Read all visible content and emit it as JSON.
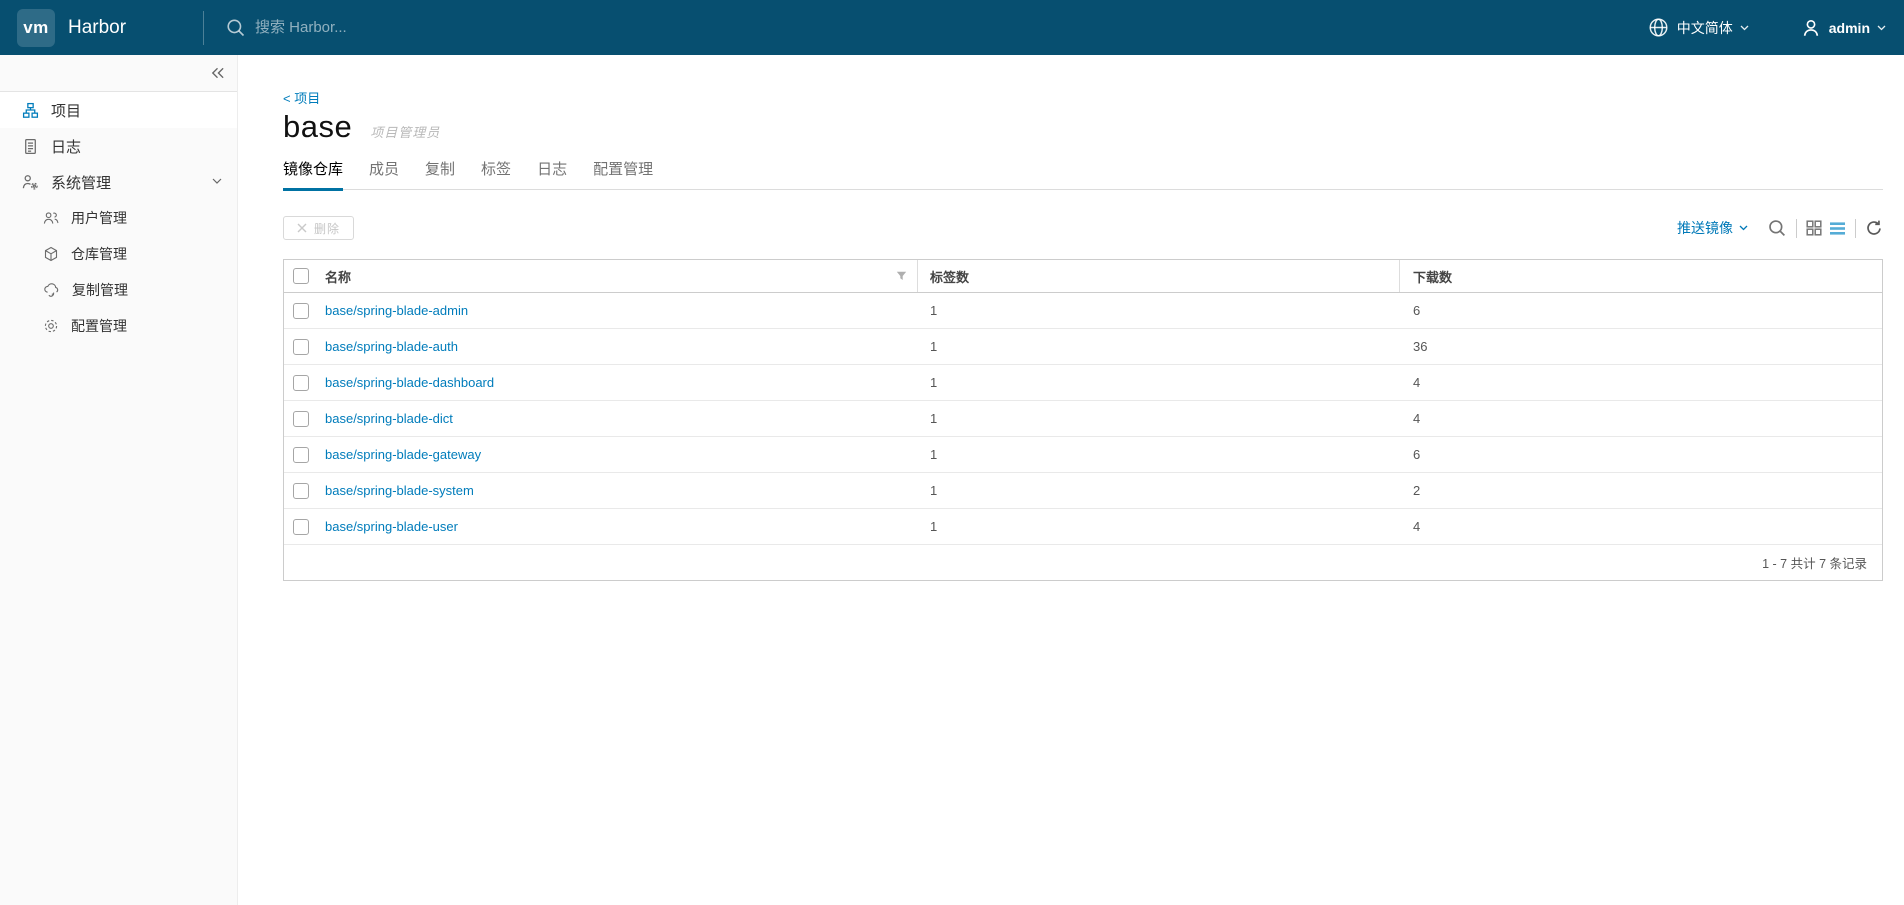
{
  "colors": {
    "header_bg": "#074F70",
    "link_blue": "#007CBB",
    "tab_active_underline": "#0072A3",
    "push_button_blue": "#0079B8",
    "sidebar_bg": "#FAFAFA"
  },
  "header": {
    "logo_text": "vm",
    "product_name": "Harbor",
    "search_placeholder": "搜索 Harbor...",
    "language_label": "中文简体",
    "user_name": "admin"
  },
  "sidebar": {
    "items": [
      {
        "label": "项目",
        "icon": "projects-icon",
        "active": true
      },
      {
        "label": "日志",
        "icon": "logs-icon",
        "active": false
      },
      {
        "label": "系统管理",
        "icon": "administration-icon",
        "active": false,
        "expanded": true
      }
    ],
    "subitems": [
      {
        "label": "用户管理",
        "icon": "users-icon"
      },
      {
        "label": "仓库管理",
        "icon": "registry-icon"
      },
      {
        "label": "复制管理",
        "icon": "replication-icon"
      },
      {
        "label": "配置管理",
        "icon": "config-icon"
      }
    ]
  },
  "main": {
    "breadcrumb": "< 项目",
    "title": "base",
    "role_label": "项目管理员",
    "tabs": [
      {
        "label": "镜像仓库",
        "active": true
      },
      {
        "label": "成员",
        "active": false
      },
      {
        "label": "复制",
        "active": false
      },
      {
        "label": "标签",
        "active": false
      },
      {
        "label": "日志",
        "active": false
      },
      {
        "label": "配置管理",
        "active": false
      }
    ],
    "toolbar": {
      "delete_label": "删除",
      "push_image_label": "推送镜像"
    },
    "table": {
      "columns": [
        {
          "label": "名称"
        },
        {
          "label": "标签数"
        },
        {
          "label": "下载数"
        }
      ],
      "rows": [
        {
          "name": "base/spring-blade-admin",
          "tags": "1",
          "pulls": "6"
        },
        {
          "name": "base/spring-blade-auth",
          "tags": "1",
          "pulls": "36"
        },
        {
          "name": "base/spring-blade-dashboard",
          "tags": "1",
          "pulls": "4"
        },
        {
          "name": "base/spring-blade-dict",
          "tags": "1",
          "pulls": "4"
        },
        {
          "name": "base/spring-blade-gateway",
          "tags": "1",
          "pulls": "6"
        },
        {
          "name": "base/spring-blade-system",
          "tags": "1",
          "pulls": "2"
        },
        {
          "name": "base/spring-blade-user",
          "tags": "1",
          "pulls": "4"
        }
      ],
      "pagination": "1 - 7 共计 7 条记录"
    }
  }
}
